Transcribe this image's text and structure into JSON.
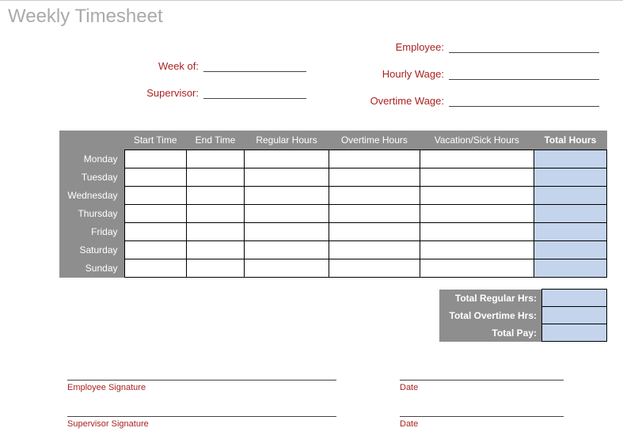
{
  "title": "Weekly Timesheet",
  "fields": {
    "week_of": "Week of:",
    "supervisor": "Supervisor:",
    "employee": "Employee:",
    "hourly_wage": "Hourly Wage:",
    "overtime_wage": "Overtime Wage:"
  },
  "columns": {
    "start": "Start Time",
    "end": "End Time",
    "regular": "Regular Hours",
    "overtime": "Overtime Hours",
    "vacation": "Vacation/Sick Hours",
    "total": "Total Hours"
  },
  "days": {
    "mon": "Monday",
    "tue": "Tuesday",
    "wed": "Wednesday",
    "thu": "Thursday",
    "fri": "Friday",
    "sat": "Saturday",
    "sun": "Sunday"
  },
  "summary": {
    "regular": "Total Regular Hrs:",
    "overtime": "Total Overtime Hrs:",
    "pay": "Total Pay:"
  },
  "signatures": {
    "employee": "Employee Signature",
    "supervisor": "Supervisor Signature",
    "date": "Date"
  }
}
